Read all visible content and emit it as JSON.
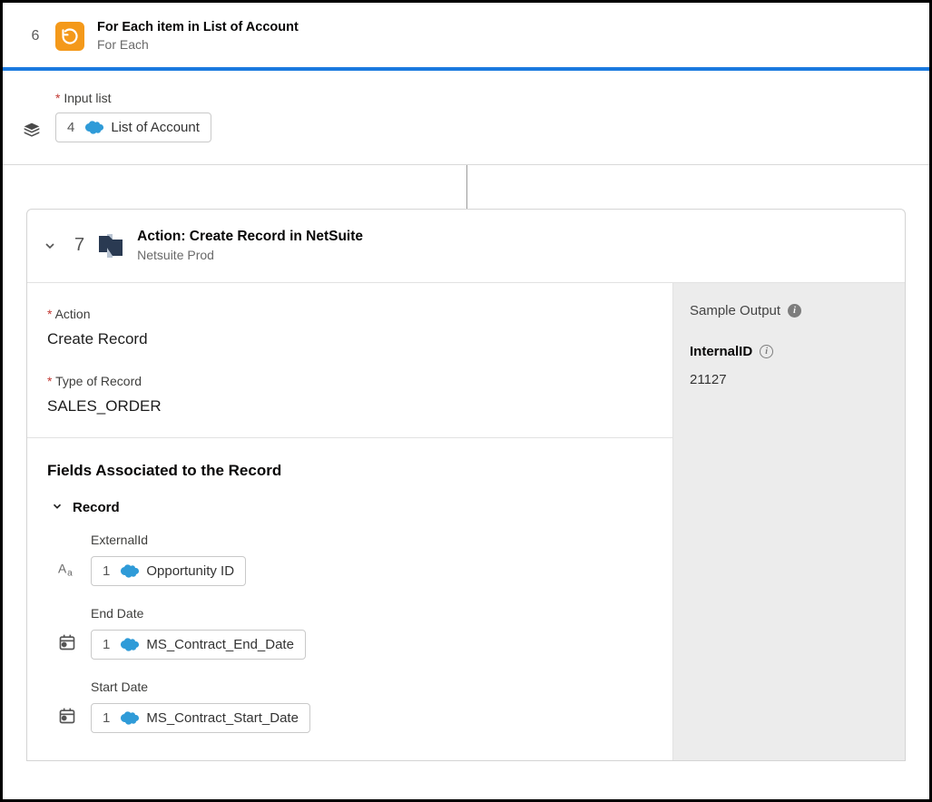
{
  "step6": {
    "number": "6",
    "title": "For Each item in List of Account",
    "subtitle": "For Each"
  },
  "input_list": {
    "label": "Input list",
    "token_step": "4",
    "token_text": "List of Account"
  },
  "step7": {
    "number": "7",
    "title": "Action: Create Record in NetSuite",
    "subtitle": "Netsuite Prod",
    "action": {
      "label": "Action",
      "value": "Create Record"
    },
    "record_type": {
      "label": "Type of Record",
      "value": "SALES_ORDER"
    },
    "fields_section_title": "Fields Associated to the Record",
    "record_group_label": "Record",
    "fields": {
      "external_id": {
        "label": "ExternalId",
        "token_step": "1",
        "token_text": "Opportunity ID"
      },
      "end_date": {
        "label": "End Date",
        "token_step": "1",
        "token_text": "MS_Contract_End_Date"
      },
      "start_date": {
        "label": "Start Date",
        "token_step": "1",
        "token_text": "MS_Contract_Start_Date"
      }
    }
  },
  "sample_output": {
    "title": "Sample Output",
    "key": "InternalID",
    "value": "21127"
  }
}
